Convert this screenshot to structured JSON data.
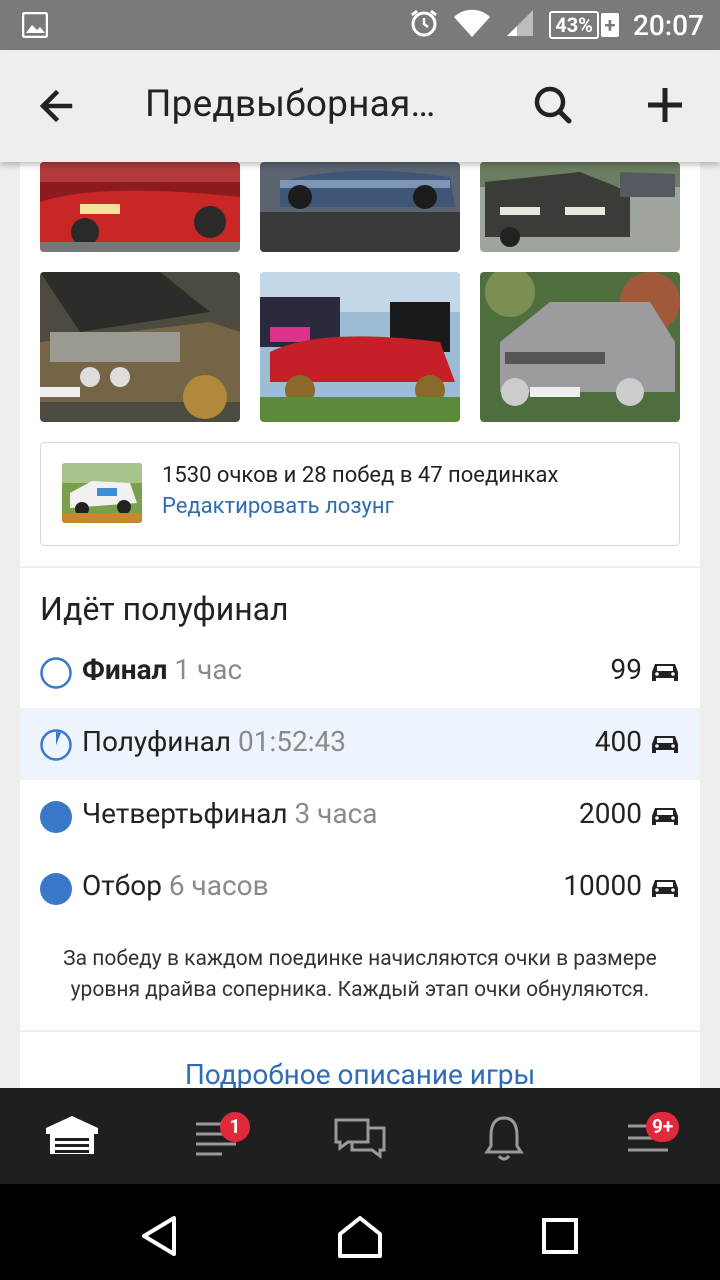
{
  "status_bar": {
    "battery_percent": "43%",
    "battery_plus": "+",
    "time": "20:07"
  },
  "app_bar": {
    "title": "Предвыборная…"
  },
  "score_card": {
    "stats": "1530 очков и 28 побед в 47 поединках",
    "edit_link": "Редактировать лозунг"
  },
  "stages": {
    "heading": "Идёт полуфинал",
    "rows": [
      {
        "name": "Финал",
        "time": "1 час",
        "count": "99",
        "state": "pending"
      },
      {
        "name": "Полуфинал",
        "time": "01:52:43",
        "count": "400",
        "state": "current"
      },
      {
        "name": "Четвертьфинал",
        "time": "3 часа",
        "count": "2000",
        "state": "done"
      },
      {
        "name": "Отбор",
        "time": "6 часов",
        "count": "10000",
        "state": "done"
      }
    ],
    "note": "За победу в каждом поединке начисляются очки в размере уровня драйва соперника. Каждый этап очки обнуляются.",
    "more_link": "Подробное описание игры"
  },
  "bottom_nav": {
    "feed_badge": "1",
    "menu_badge": "9+"
  },
  "colors": {
    "accent": "#2e6db6",
    "status_blue": "#3a78c9",
    "badge_red": "#e0293b",
    "active_row": "#eef4fc"
  },
  "icons": [
    "back-arrow-icon",
    "search-icon",
    "plus-icon",
    "car-icon",
    "garage-icon",
    "feed-icon",
    "chat-icon",
    "bell-icon",
    "menu-icon"
  ]
}
